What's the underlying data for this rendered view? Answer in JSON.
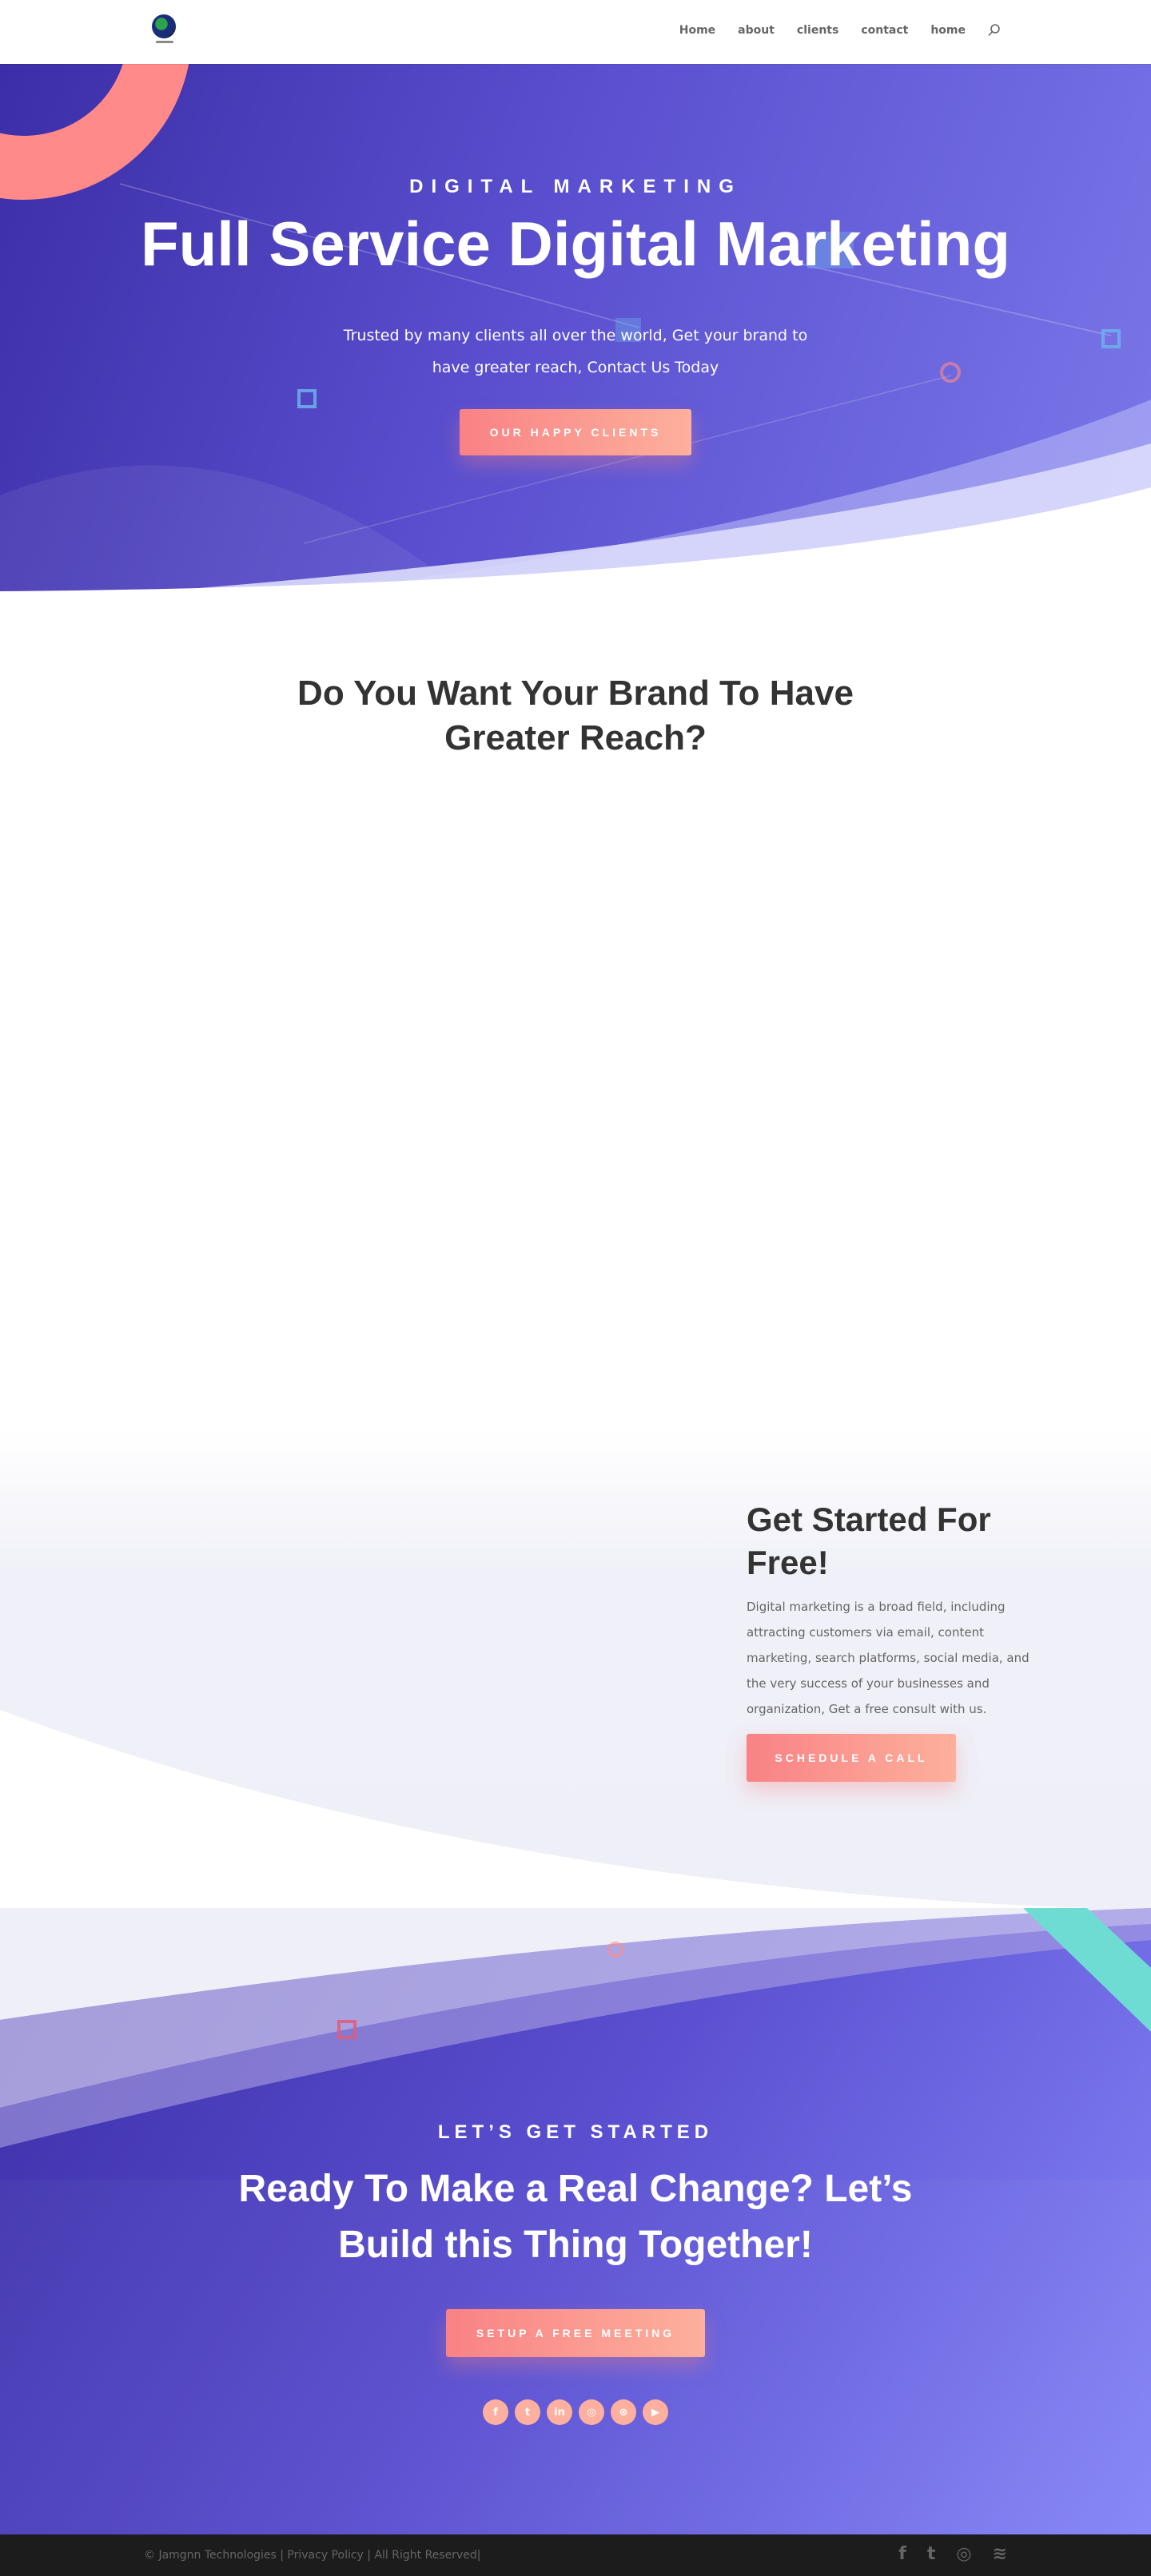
{
  "header": {
    "logo_icon": "company-logo",
    "nav": [
      "Home",
      "about",
      "clients",
      "contact",
      "home"
    ],
    "search_icon": "search-icon"
  },
  "hero": {
    "kicker": "DIGITAL MARKETING",
    "title": "Full Service Digital Marketing",
    "description": "Trusted by many clients all over the world, Get your brand to have greater reach, Contact Us Today",
    "button": "OUR HAPPY CLIENTS"
  },
  "reach": {
    "title": "Do You Want Your Brand To Have Greater Reach?"
  },
  "get_started": {
    "title": "Get Started For Free!",
    "text": "Digital marketing is a broad field, including attracting customers via email, content marketing, search platforms, social media, and the very success of your businesses and organization, Get a free consult with us.",
    "button": "SCHEDULE A CALL"
  },
  "cta": {
    "kicker": "LET’S GET STARTED",
    "title": "Ready To Make a Real Change? Let’s Build this Thing Together!",
    "button": "SETUP A FREE MEETING",
    "social": [
      {
        "icon": "facebook-icon",
        "glyph": "f"
      },
      {
        "icon": "twitter-icon",
        "glyph": "t"
      },
      {
        "icon": "linkedin-icon",
        "glyph": "in"
      },
      {
        "icon": "instagram-icon",
        "glyph": "◎"
      },
      {
        "icon": "dribbble-icon",
        "glyph": "⊛"
      },
      {
        "icon": "youtube-icon",
        "glyph": "▶"
      }
    ]
  },
  "footer": {
    "text": "© Jamgnn Technologies | Privacy Policy | All Right Reserved|",
    "icons": [
      {
        "icon": "facebook-icon",
        "glyph": "f"
      },
      {
        "icon": "twitter-icon",
        "glyph": "t"
      },
      {
        "icon": "instagram-icon",
        "glyph": "◎"
      },
      {
        "icon": "rss-icon",
        "glyph": "≋"
      }
    ]
  },
  "colors": {
    "accent": "#f98285",
    "hero_purple": "#5a4fcf",
    "teal": "#6fdcd3"
  }
}
